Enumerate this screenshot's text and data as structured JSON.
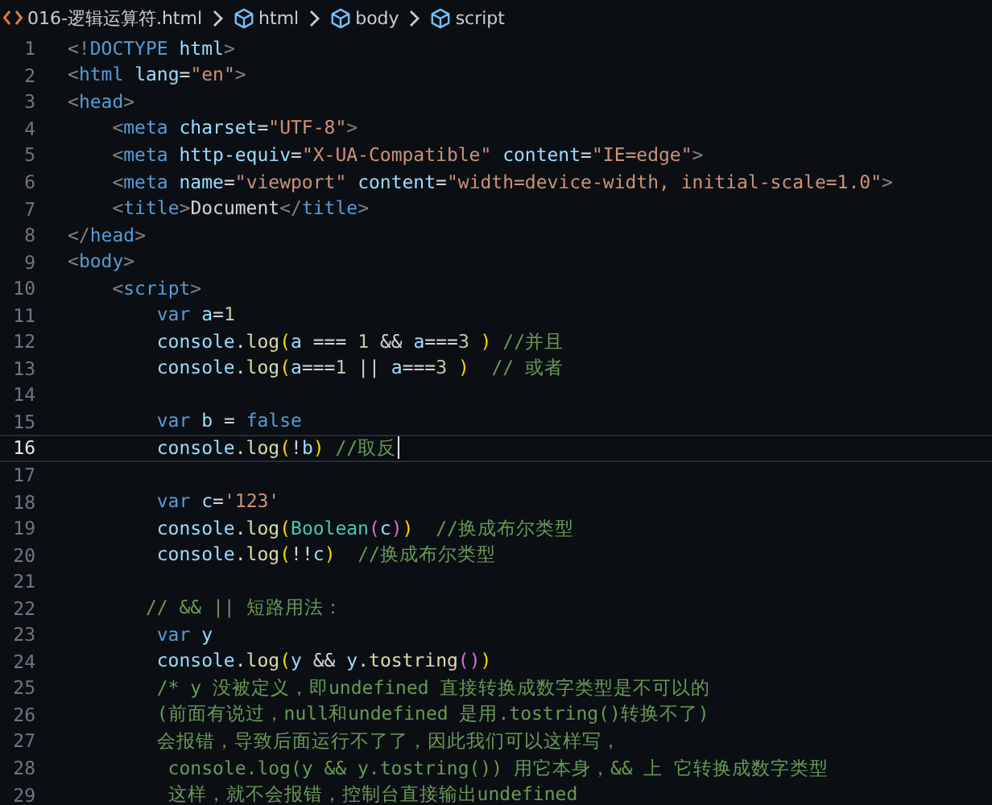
{
  "breadcrumbs": [
    {
      "kind": "file",
      "label": "016-逻辑运算符.html"
    },
    {
      "kind": "element",
      "label": "html"
    },
    {
      "kind": "element",
      "label": "body"
    },
    {
      "kind": "element",
      "label": "script"
    }
  ],
  "lines": [
    {
      "number": "1",
      "active": false,
      "tokens": [
        {
          "kind": "p",
          "text": "<!"
        },
        {
          "kind": "tag",
          "text": "DOCTYPE"
        },
        {
          "kind": "attr",
          "text": " html"
        },
        {
          "kind": "p",
          "text": ">"
        }
      ]
    },
    {
      "number": "2",
      "active": false,
      "tokens": [
        {
          "kind": "p",
          "text": "<"
        },
        {
          "kind": "tag",
          "text": "html"
        },
        {
          "kind": "attr",
          "text": " lang"
        },
        {
          "kind": "txt",
          "text": "="
        },
        {
          "kind": "str",
          "text": "\"en\""
        },
        {
          "kind": "p",
          "text": ">"
        }
      ]
    },
    {
      "number": "3",
      "active": false,
      "tokens": [
        {
          "kind": "p",
          "text": "<"
        },
        {
          "kind": "tag",
          "text": "head"
        },
        {
          "kind": "p",
          "text": ">"
        }
      ]
    },
    {
      "number": "4",
      "active": false,
      "tokens": [
        {
          "kind": "p",
          "text": "    <"
        },
        {
          "kind": "tag",
          "text": "meta"
        },
        {
          "kind": "attr",
          "text": " charset"
        },
        {
          "kind": "txt",
          "text": "="
        },
        {
          "kind": "str",
          "text": "\"UTF-8\""
        },
        {
          "kind": "p",
          "text": ">"
        }
      ]
    },
    {
      "number": "5",
      "active": false,
      "tokens": [
        {
          "kind": "p",
          "text": "    <"
        },
        {
          "kind": "tag",
          "text": "meta"
        },
        {
          "kind": "attr",
          "text": " http-equiv"
        },
        {
          "kind": "txt",
          "text": "="
        },
        {
          "kind": "str",
          "text": "\"X-UA-Compatible\""
        },
        {
          "kind": "attr",
          "text": " content"
        },
        {
          "kind": "txt",
          "text": "="
        },
        {
          "kind": "str",
          "text": "\"IE=edge\""
        },
        {
          "kind": "p",
          "text": ">"
        }
      ]
    },
    {
      "number": "6",
      "active": false,
      "tokens": [
        {
          "kind": "p",
          "text": "    <"
        },
        {
          "kind": "tag",
          "text": "meta"
        },
        {
          "kind": "attr",
          "text": " name"
        },
        {
          "kind": "txt",
          "text": "="
        },
        {
          "kind": "str",
          "text": "\"viewport\""
        },
        {
          "kind": "attr",
          "text": " content"
        },
        {
          "kind": "txt",
          "text": "="
        },
        {
          "kind": "str",
          "text": "\"width=device-width, initial-scale=1.0\""
        },
        {
          "kind": "p",
          "text": ">"
        }
      ]
    },
    {
      "number": "7",
      "active": false,
      "tokens": [
        {
          "kind": "p",
          "text": "    <"
        },
        {
          "kind": "tag",
          "text": "title"
        },
        {
          "kind": "p",
          "text": ">"
        },
        {
          "kind": "txt",
          "text": "Document"
        },
        {
          "kind": "p",
          "text": "</"
        },
        {
          "kind": "tag",
          "text": "title"
        },
        {
          "kind": "p",
          "text": ">"
        }
      ]
    },
    {
      "number": "8",
      "active": false,
      "tokens": [
        {
          "kind": "p",
          "text": "</"
        },
        {
          "kind": "tag",
          "text": "head"
        },
        {
          "kind": "p",
          "text": ">"
        }
      ]
    },
    {
      "number": "9",
      "active": false,
      "tokens": [
        {
          "kind": "p",
          "text": "<"
        },
        {
          "kind": "tag",
          "text": "body"
        },
        {
          "kind": "p",
          "text": ">"
        }
      ]
    },
    {
      "number": "10",
      "active": false,
      "tokens": [
        {
          "kind": "p",
          "text": "    <"
        },
        {
          "kind": "tag",
          "text": "script"
        },
        {
          "kind": "p",
          "text": ">"
        }
      ]
    },
    {
      "number": "11",
      "active": false,
      "tokens": [
        {
          "kind": "kw",
          "text": "        var"
        },
        {
          "kind": "var",
          "text": " a"
        },
        {
          "kind": "txt",
          "text": "="
        },
        {
          "kind": "num",
          "text": "1"
        }
      ]
    },
    {
      "number": "12",
      "active": false,
      "tokens": [
        {
          "kind": "var",
          "text": "        console"
        },
        {
          "kind": "txt",
          "text": "."
        },
        {
          "kind": "fn",
          "text": "log"
        },
        {
          "kind": "br",
          "text": "("
        },
        {
          "kind": "var",
          "text": "a"
        },
        {
          "kind": "txt",
          "text": " === "
        },
        {
          "kind": "num",
          "text": "1"
        },
        {
          "kind": "txt",
          "text": " && "
        },
        {
          "kind": "var",
          "text": "a"
        },
        {
          "kind": "txt",
          "text": "==="
        },
        {
          "kind": "num",
          "text": "3"
        },
        {
          "kind": "br",
          "text": " )"
        },
        {
          "kind": "cm",
          "text": " //并且"
        }
      ]
    },
    {
      "number": "13",
      "active": false,
      "tokens": [
        {
          "kind": "var",
          "text": "        console"
        },
        {
          "kind": "txt",
          "text": "."
        },
        {
          "kind": "fn",
          "text": "log"
        },
        {
          "kind": "br",
          "text": "("
        },
        {
          "kind": "var",
          "text": "a"
        },
        {
          "kind": "txt",
          "text": "==="
        },
        {
          "kind": "num",
          "text": "1"
        },
        {
          "kind": "txt",
          "text": " || "
        },
        {
          "kind": "var",
          "text": "a"
        },
        {
          "kind": "txt",
          "text": "==="
        },
        {
          "kind": "num",
          "text": "3"
        },
        {
          "kind": "br",
          "text": " )"
        },
        {
          "kind": "cm",
          "text": "  // 或者"
        }
      ]
    },
    {
      "number": "14",
      "active": false
    },
    {
      "number": "15",
      "active": false,
      "tokens": [
        {
          "kind": "kw",
          "text": "        var"
        },
        {
          "kind": "var",
          "text": " b"
        },
        {
          "kind": "txt",
          "text": " = "
        },
        {
          "kind": "kw",
          "text": "false"
        }
      ]
    },
    {
      "number": "16",
      "active": true,
      "tokens": [
        {
          "kind": "var",
          "text": "        console"
        },
        {
          "kind": "txt",
          "text": "."
        },
        {
          "kind": "fn",
          "text": "log"
        },
        {
          "kind": "br",
          "text": "("
        },
        {
          "kind": "txt",
          "text": "!"
        },
        {
          "kind": "var",
          "text": "b"
        },
        {
          "kind": "br",
          "text": ")"
        },
        {
          "kind": "cm",
          "text": " //取反"
        }
      ]
    },
    {
      "number": "17",
      "active": false
    },
    {
      "number": "18",
      "active": false,
      "tokens": [
        {
          "kind": "kw",
          "text": "        var"
        },
        {
          "kind": "var",
          "text": " c"
        },
        {
          "kind": "txt",
          "text": "="
        },
        {
          "kind": "str",
          "text": "'123'"
        }
      ]
    },
    {
      "number": "19",
      "active": false,
      "tokens": [
        {
          "kind": "var",
          "text": "        console"
        },
        {
          "kind": "txt",
          "text": "."
        },
        {
          "kind": "fn",
          "text": "log"
        },
        {
          "kind": "br",
          "text": "("
        },
        {
          "kind": "cls",
          "text": "Boolean"
        },
        {
          "kind": "br2",
          "text": "("
        },
        {
          "kind": "var",
          "text": "c"
        },
        {
          "kind": "br2",
          "text": ")"
        },
        {
          "kind": "br",
          "text": ")"
        },
        {
          "kind": "cm",
          "text": "  //换成布尔类型"
        }
      ]
    },
    {
      "number": "20",
      "active": false,
      "tokens": [
        {
          "kind": "var",
          "text": "        console"
        },
        {
          "kind": "txt",
          "text": "."
        },
        {
          "kind": "fn",
          "text": "log"
        },
        {
          "kind": "br",
          "text": "("
        },
        {
          "kind": "txt",
          "text": "!!"
        },
        {
          "kind": "var",
          "text": "c"
        },
        {
          "kind": "br",
          "text": ")"
        },
        {
          "kind": "cm",
          "text": "  //换成布尔类型"
        }
      ]
    },
    {
      "number": "21",
      "active": false
    },
    {
      "number": "22",
      "active": false,
      "tokens": [
        {
          "kind": "cm",
          "text": "       // && || 短路用法："
        }
      ]
    },
    {
      "number": "23",
      "active": false,
      "tokens": [
        {
          "kind": "kw",
          "text": "        var"
        },
        {
          "kind": "var",
          "text": " y"
        }
      ]
    },
    {
      "number": "24",
      "active": false,
      "tokens": [
        {
          "kind": "var",
          "text": "        console"
        },
        {
          "kind": "txt",
          "text": "."
        },
        {
          "kind": "fn",
          "text": "log"
        },
        {
          "kind": "br",
          "text": "("
        },
        {
          "kind": "var",
          "text": "y"
        },
        {
          "kind": "txt",
          "text": " && "
        },
        {
          "kind": "var",
          "text": "y"
        },
        {
          "kind": "txt",
          "text": "."
        },
        {
          "kind": "fn",
          "text": "tostring"
        },
        {
          "kind": "br2",
          "text": "()"
        },
        {
          "kind": "br",
          "text": ")"
        }
      ]
    },
    {
      "number": "25",
      "active": false,
      "tokens": [
        {
          "kind": "cm",
          "text": "        /* y 没被定义，即undefined 直接转换成数字类型是不可以的"
        }
      ]
    },
    {
      "number": "26",
      "active": false,
      "tokens": [
        {
          "kind": "cm",
          "text": "        (前面有说过，null和undefined 是用.tostring()转换不了)"
        }
      ]
    },
    {
      "number": "27",
      "active": false,
      "tokens": [
        {
          "kind": "cm",
          "text": "        会报错，导致后面运行不了了，因此我们可以这样写，"
        }
      ]
    },
    {
      "number": "28",
      "active": false,
      "tokens": [
        {
          "kind": "cm",
          "text": "         console.log(y && y.tostring()) 用它本身，&& 上 它转换成数字类型"
        }
      ]
    },
    {
      "number": "29",
      "active": false,
      "tokens": [
        {
          "kind": "cm",
          "text": "         这样，就不会报错，控制台直接输出undefined"
        }
      ]
    }
  ]
}
